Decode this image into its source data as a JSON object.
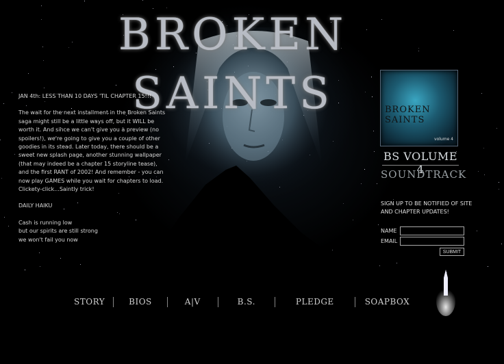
{
  "logo": {
    "text": "BROKEN SAINTS"
  },
  "news": {
    "heading": "JAN 4th:  LESS THAN 10 DAYS 'TIL CHAPTER 15!!!",
    "body": "The wait for the next installment in the Broken Saints saga might still be a little ways off, but it WILL be worth it.  And since we can't give you a preview (no spoilers!), we're going to give you a couple of other goodies in its stead.  Later today, there should be a sweet new splash page, another stunning wallpaper (that may indeed be a chapter 15 storyline tease), and the first RANT of 2002! And remember - you can now play GAMES while you wait for chapters to load. Clickety-click...Saintly trick!",
    "haiku_title": "DAILY HAIKU",
    "haiku_lines": [
      "Cash is running low",
      "but our spirits are still strong",
      "we won't fail you now"
    ]
  },
  "album": {
    "cover_title": "BROKEN SAINTS",
    "cover_mark": "volume 4",
    "title": "BS VOLUME 4",
    "subtitle": "SOUNDTRACK"
  },
  "signup": {
    "text": "SIGN UP TO BE NOTIFIED OF SITE AND CHAPTER UPDATES!",
    "name_label": "NAME",
    "email_label": "EMAIL",
    "name_value": "",
    "email_value": "",
    "submit_label": "SUBMIT"
  },
  "nav": [
    "STORY",
    "BIOS",
    "A|V",
    "B.S.",
    "PLEDGE",
    "SOAPBOX"
  ]
}
